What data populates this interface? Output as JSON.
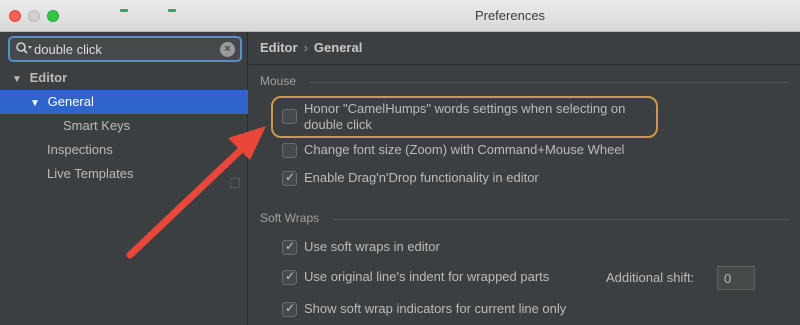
{
  "window": {
    "title": "Preferences"
  },
  "search": {
    "value": "double click"
  },
  "sidebar": {
    "items": [
      {
        "label": "Editor"
      },
      {
        "label": "General"
      },
      {
        "label": "Smart Keys"
      },
      {
        "label": "Inspections"
      },
      {
        "label": "Live Templates"
      }
    ]
  },
  "breadcrumb": {
    "parent": "Editor",
    "separator": "›",
    "current": "General"
  },
  "mouse": {
    "heading": "Mouse",
    "options": [
      {
        "label_line1": "Honor \"CamelHumps\" words settings when selecting on",
        "label_line2": "double click",
        "checked": false
      },
      {
        "label": "Change font size (Zoom) with Command+Mouse Wheel",
        "checked": false
      },
      {
        "label": "Enable Drag'n'Drop functionality in editor",
        "checked": true
      }
    ]
  },
  "softwraps": {
    "heading": "Soft Wraps",
    "options": [
      {
        "label": "Use soft wraps in editor",
        "checked": true
      },
      {
        "label": "Use original line's indent for wrapped parts",
        "checked": true
      },
      {
        "label": "Show soft wrap indicators for current line only",
        "checked": true
      }
    ],
    "additional_shift_label": "Additional shift:",
    "additional_shift_value": "0"
  },
  "colors": {
    "accent": "#2f65ca",
    "highlight": "#c99a4a",
    "arrow": "#e8473a"
  }
}
